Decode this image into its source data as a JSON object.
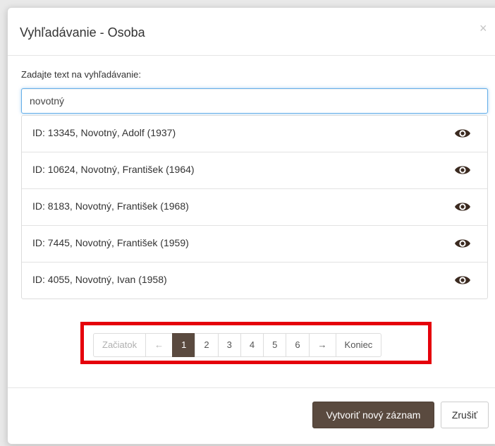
{
  "dialog": {
    "title": "Vyhľadávanie - Osoba",
    "close_symbol": "×"
  },
  "search": {
    "label": "Zadajte text na vyhľadávanie:",
    "value": "novotný"
  },
  "results": [
    {
      "text": "ID: 13345, Novotný, Adolf (1937)",
      "action_icon": "eye-icon"
    },
    {
      "text": "ID: 10624, Novotný, František (1964)",
      "action_icon": "eye-icon"
    },
    {
      "text": "ID: 8183, Novotný, František (1968)",
      "action_icon": "eye-icon"
    },
    {
      "text": "ID: 7445, Novotný, František (1959)",
      "action_icon": "eye-icon"
    },
    {
      "text": "ID: 4055, Novotný, Ivan (1958)",
      "action_icon": "eye-icon"
    }
  ],
  "pagination": {
    "first": "Začiatok",
    "prev": "←",
    "pages": [
      "1",
      "2",
      "3",
      "4",
      "5",
      "6"
    ],
    "active_page": "1",
    "next": "→",
    "last": "Koniec",
    "highlight_color": "#e5000b"
  },
  "footer": {
    "create_label": "Vytvoriť nový záznam",
    "cancel_label": "Zrušiť"
  },
  "colors": {
    "primary": "#5a4a3f",
    "eye_icon": "#3b2a20",
    "focus_border": "#66afe9"
  }
}
